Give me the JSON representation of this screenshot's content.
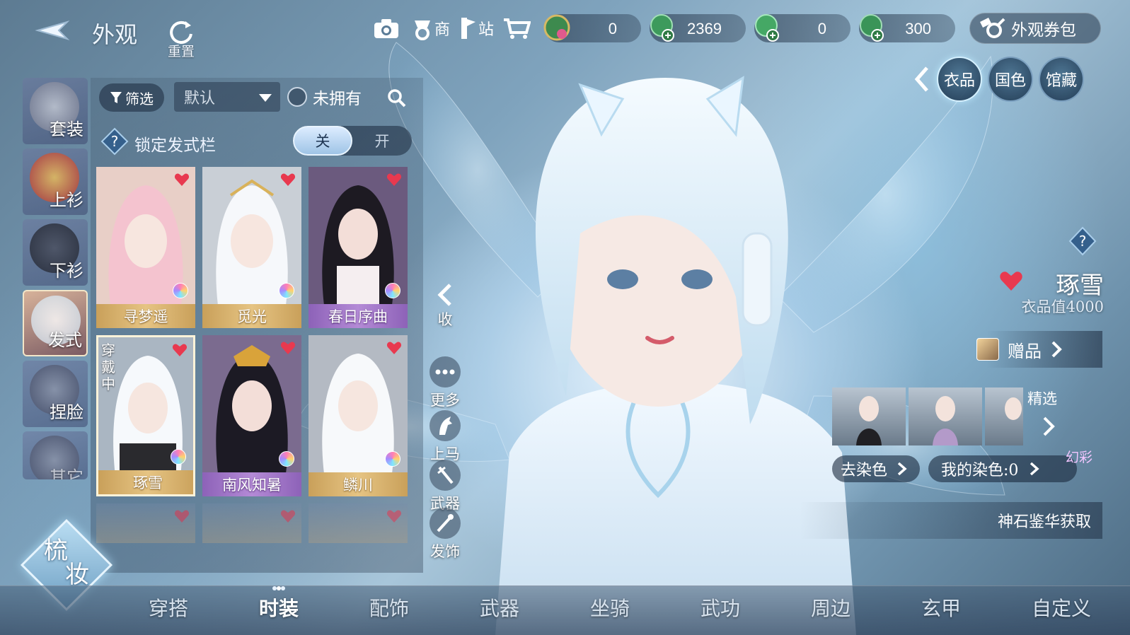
{
  "header": {
    "title": "外观",
    "reset_label": "重置",
    "icons": [
      "camera-icon",
      "shop-icon",
      "station-icon",
      "cart-icon"
    ],
    "shop_label": "商",
    "station_label": "站",
    "currencies": [
      {
        "name": "orb-currency-icon",
        "value": "0"
      },
      {
        "name": "jade-currency-icon",
        "value": "2369"
      },
      {
        "name": "jade-bound-currency-icon",
        "value": "0"
      },
      {
        "name": "jade-token-currency-icon",
        "value": "300"
      }
    ],
    "voucher_label": "外观券包"
  },
  "right_tabs": [
    "衣品",
    "国色",
    "馆藏"
  ],
  "categories": [
    "套装",
    "上衫",
    "下衫",
    "发式",
    "捏脸",
    "其它"
  ],
  "filter": {
    "filter_label": "筛选",
    "sort_value": "默认",
    "unowned_label": "未拥有"
  },
  "lock_row": {
    "label": "锁定发式栏",
    "off_label": "关",
    "on_label": "开"
  },
  "items": [
    {
      "name": "寻梦遥",
      "style": "gold"
    },
    {
      "name": "觅光",
      "style": "gold"
    },
    {
      "name": "春日序曲",
      "style": "purple"
    },
    {
      "name": "琢雪",
      "style": "gold",
      "wearing": true
    },
    {
      "name": "南风知暑",
      "style": "purple"
    },
    {
      "name": "鳞川",
      "style": "gold"
    }
  ],
  "wearing_tag": "穿戴中",
  "side_actions": [
    "收",
    "更多",
    "上马",
    "武器",
    "发饰"
  ],
  "selected_item": {
    "name": "琢雪",
    "value_text": "衣品值4000",
    "gift_label": "赠品",
    "featured_label": "精选",
    "dye_label": "去染色",
    "my_dye_label": "我的染色:0",
    "huancai_label": "幻彩",
    "source_label": "神石鉴华获取"
  },
  "logo": {
    "line1": "梳",
    "line2": "妆"
  },
  "bottom_nav": [
    "穿搭",
    "时装",
    "配饰",
    "武器",
    "坐骑",
    "武功",
    "周边",
    "玄甲",
    "自定义"
  ],
  "bottom_nav_active": "时装",
  "colors": {
    "heart": "#e8394f",
    "card_gold": "#d9b26b",
    "card_purple": "#a57bcc",
    "accent_blue": "#cfe8ff"
  }
}
